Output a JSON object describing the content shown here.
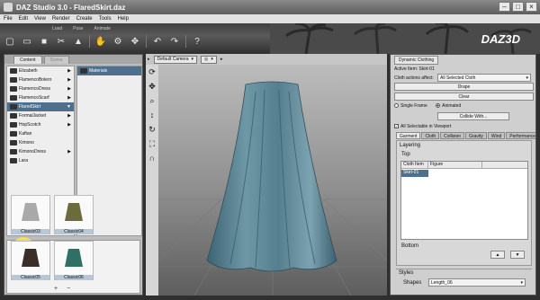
{
  "window": {
    "title": "DAZ Studio 3.0 - FlaredSkirt.daz",
    "logo": "DAZ3D"
  },
  "menu": [
    "File",
    "Edit",
    "View",
    "Render",
    "Create",
    "Tools",
    "Help"
  ],
  "toolbar": {
    "tabs": [
      "Load",
      "Pose",
      "Animate"
    ],
    "icons": [
      "new-icon",
      "open-icon",
      "save-icon",
      "cut-icon",
      "figure-icon",
      "pose-icon",
      "joint-icon",
      "move-icon",
      "undo-icon",
      "redo-icon",
      "help-icon"
    ]
  },
  "content_panel": {
    "tabs": [
      "Content",
      "Scene"
    ],
    "folders": [
      "Elizabeth",
      "FlamencoBolero",
      "FlamencoDress",
      "FlamencoScarf",
      "FlaredSkirt",
      "FormalJacket",
      "HopScotch",
      "Kaftan",
      "Kimono",
      "KimonoDress",
      "Lara"
    ],
    "selected_folder": "FlaredSkirt",
    "subfolder": "Materials",
    "thumbnails": [
      "Classic03",
      "Classic04",
      "Classic05",
      "Classic06"
    ]
  },
  "viewport": {
    "camera": "Default Camera",
    "tools": [
      "rotate-icon",
      "pan-icon",
      "zoom-icon",
      "dolly-icon",
      "orbit-icon",
      "frame-icon",
      "reset-icon"
    ]
  },
  "dynamic_clothing": {
    "tab": "Dynamic Clothing",
    "active_item_label": "Active Item:",
    "active_item_value": "Skirt-01",
    "actions_label": "Cloth actions affect:",
    "actions_value": "All Selected Cloth",
    "drape_label": "Drape",
    "clear_label": "Clear",
    "single_frame_label": "Single Frame",
    "animated_label": "Animated",
    "collide_label": "Collide With...",
    "selectable_label": "All Selectable in Viewport",
    "tabs": [
      "Garment",
      "Cloth",
      "Collision",
      "Gravity",
      "Wind",
      "Performance"
    ],
    "layering_label": "Layering",
    "top_label": "Top",
    "bottom_label": "Bottom",
    "table_headers": [
      "Cloth Item",
      "Figure"
    ],
    "table_row": "Skirt-01",
    "styles_label": "Styles",
    "shapes_label": "Shapes",
    "shapes_value": "Length_06"
  },
  "colors": {
    "selected": "#4e6f8e",
    "cloth": "#557f8f"
  }
}
